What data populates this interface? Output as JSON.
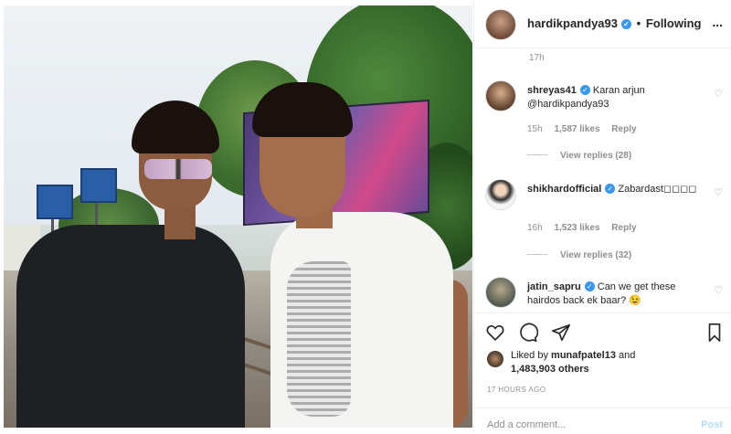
{
  "header": {
    "username": "hardikpandya93",
    "verified": "✓",
    "dot": "•",
    "follow_status": "Following",
    "menu": "..."
  },
  "caption_time": "17h",
  "comments": [
    {
      "username": "shreyas41",
      "verified": "✓",
      "text": "Karan arjun @hardikpandya93",
      "time": "15h",
      "likes": "1,587 likes",
      "reply": "Reply",
      "view_replies": "View replies (28)"
    },
    {
      "username": "shikhardofficial",
      "verified": "✓",
      "text": "Zabardast◻◻◻◻",
      "time": "16h",
      "likes": "1,523 likes",
      "reply": "Reply",
      "view_replies": "View replies (32)"
    },
    {
      "username": "jatin_sapru",
      "verified": "✓",
      "text": "Can we get these hairdos back ek baar? 😉"
    }
  ],
  "likes": {
    "prefix": "Liked by",
    "liker": "munafpatel13",
    "and": "and",
    "count": "1,483,903 others"
  },
  "post_time": "17 HOURS AGO",
  "add_comment": {
    "placeholder": "Add a comment...",
    "post": "Post"
  },
  "icons": {
    "heart": "heart-icon",
    "comment": "comment-icon",
    "share": "share-icon",
    "bookmark": "bookmark-icon"
  }
}
